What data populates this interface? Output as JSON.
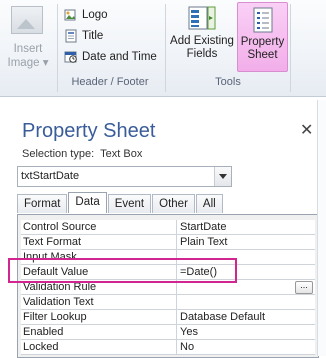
{
  "ribbon": {
    "insert_image": {
      "line1": "Insert",
      "line2": "Image ▾"
    },
    "header_footer": {
      "items": [
        "Logo",
        "Title",
        "Date and Time"
      ],
      "label": "Header / Footer"
    },
    "tools": {
      "add_fields": {
        "line1": "Add Existing",
        "line2": "Fields"
      },
      "property_sheet": {
        "line1": "Property",
        "line2": "Sheet"
      },
      "label": "Tools"
    }
  },
  "pane": {
    "title": "Property Sheet",
    "close": "✕",
    "selection_type_label": "Selection type:",
    "selection_type_value": "Text Box",
    "object_combo": "txtStartDate",
    "tabs": [
      "Format",
      "Data",
      "Event",
      "Other",
      "All"
    ],
    "active_tab": "Data",
    "properties": [
      {
        "name": "Control Source",
        "value": "StartDate"
      },
      {
        "name": "Text Format",
        "value": "Plain Text"
      },
      {
        "name": "Input Mask",
        "value": ""
      },
      {
        "name": "Default Value",
        "value": "=Date()"
      },
      {
        "name": "Validation Rule",
        "value": ""
      },
      {
        "name": "Validation Text",
        "value": ""
      },
      {
        "name": "Filter Lookup",
        "value": "Database Default"
      },
      {
        "name": "Enabled",
        "value": "Yes"
      },
      {
        "name": "Locked",
        "value": "No"
      }
    ],
    "builder_button": "...",
    "highlight_color": "#d1268f",
    "title_color": "#3a5d9a"
  }
}
